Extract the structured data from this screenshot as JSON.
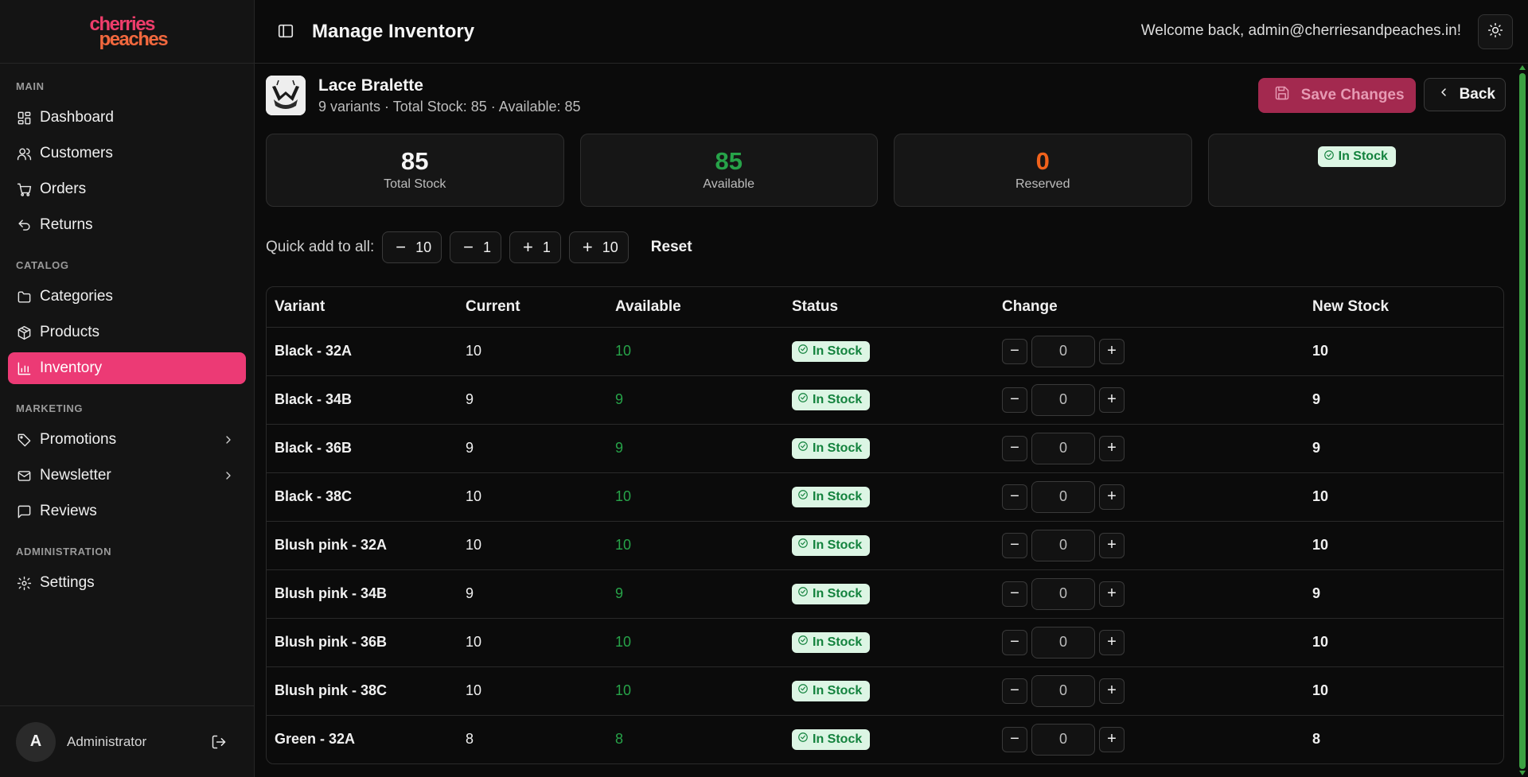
{
  "brand": {
    "line1": "cherries",
    "line2": "peaches"
  },
  "sidebar": {
    "sections": [
      {
        "label": "MAIN",
        "items": [
          {
            "label": "Dashboard",
            "icon": "dashboard-icon"
          },
          {
            "label": "Customers",
            "icon": "users-icon"
          },
          {
            "label": "Orders",
            "icon": "cart-icon"
          },
          {
            "label": "Returns",
            "icon": "undo-icon"
          }
        ]
      },
      {
        "label": "CATALOG",
        "items": [
          {
            "label": "Categories",
            "icon": "folder-icon"
          },
          {
            "label": "Products",
            "icon": "package-icon"
          },
          {
            "label": "Inventory",
            "icon": "bar-chart-icon",
            "active": true
          }
        ]
      },
      {
        "label": "MARKETING",
        "items": [
          {
            "label": "Promotions",
            "icon": "tag-icon"
          },
          {
            "label": "Newsletter",
            "icon": "mail-icon"
          },
          {
            "label": "Reviews",
            "icon": "message-square-icon"
          }
        ]
      },
      {
        "label": "ADMINISTRATION",
        "items": [
          {
            "label": "Settings",
            "icon": "gear-icon"
          }
        ]
      }
    ],
    "user": {
      "initial": "A",
      "name": "Administrator"
    }
  },
  "header": {
    "title": "Manage Inventory",
    "welcome": "Welcome back, admin@cherriesandpeaches.in!"
  },
  "product": {
    "name": "Lace Bralette",
    "meta": "9 variants · Total Stock: 85 · Available: 85",
    "save_label": "Save Changes",
    "back_label": "Back"
  },
  "stats": {
    "total": {
      "value": "85",
      "label": "Total Stock"
    },
    "available": {
      "value": "85",
      "label": "Available"
    },
    "reserved": {
      "value": "0",
      "label": "Reserved"
    },
    "status": "In Stock"
  },
  "quick_add": {
    "label": "Quick add to all:",
    "buttons": [
      {
        "op": "−",
        "amount": "10"
      },
      {
        "op": "−",
        "amount": "1"
      },
      {
        "op": "+",
        "amount": "1"
      },
      {
        "op": "+",
        "amount": "10"
      }
    ],
    "reset_label": "Reset"
  },
  "table": {
    "headers": [
      "Variant",
      "Current",
      "Available",
      "Status",
      "Change",
      "New Stock"
    ],
    "rows": [
      {
        "variant": "Black - 32A",
        "current": "10",
        "available": "10",
        "status": "In Stock",
        "change": "0",
        "new_stock": "10"
      },
      {
        "variant": "Black - 34B",
        "current": "9",
        "available": "9",
        "status": "In Stock",
        "change": "0",
        "new_stock": "9"
      },
      {
        "variant": "Black - 36B",
        "current": "9",
        "available": "9",
        "status": "In Stock",
        "change": "0",
        "new_stock": "9"
      },
      {
        "variant": "Black - 38C",
        "current": "10",
        "available": "10",
        "status": "In Stock",
        "change": "0",
        "new_stock": "10"
      },
      {
        "variant": "Blush pink - 32A",
        "current": "10",
        "available": "10",
        "status": "In Stock",
        "change": "0",
        "new_stock": "10"
      },
      {
        "variant": "Blush pink - 34B",
        "current": "9",
        "available": "9",
        "status": "In Stock",
        "change": "0",
        "new_stock": "9"
      },
      {
        "variant": "Blush pink - 36B",
        "current": "10",
        "available": "10",
        "status": "In Stock",
        "change": "0",
        "new_stock": "10"
      },
      {
        "variant": "Blush pink - 38C",
        "current": "10",
        "available": "10",
        "status": "In Stock",
        "change": "0",
        "new_stock": "10"
      },
      {
        "variant": "Green - 32A",
        "current": "8",
        "available": "8",
        "status": "In Stock",
        "change": "0",
        "new_stock": "8"
      }
    ]
  },
  "colors": {
    "accent": "#ec3a75",
    "available_green": "#27a349",
    "reserved_orange": "#f0621c",
    "badge_bg": "#dcf5e4",
    "badge_text": "#13823d"
  }
}
